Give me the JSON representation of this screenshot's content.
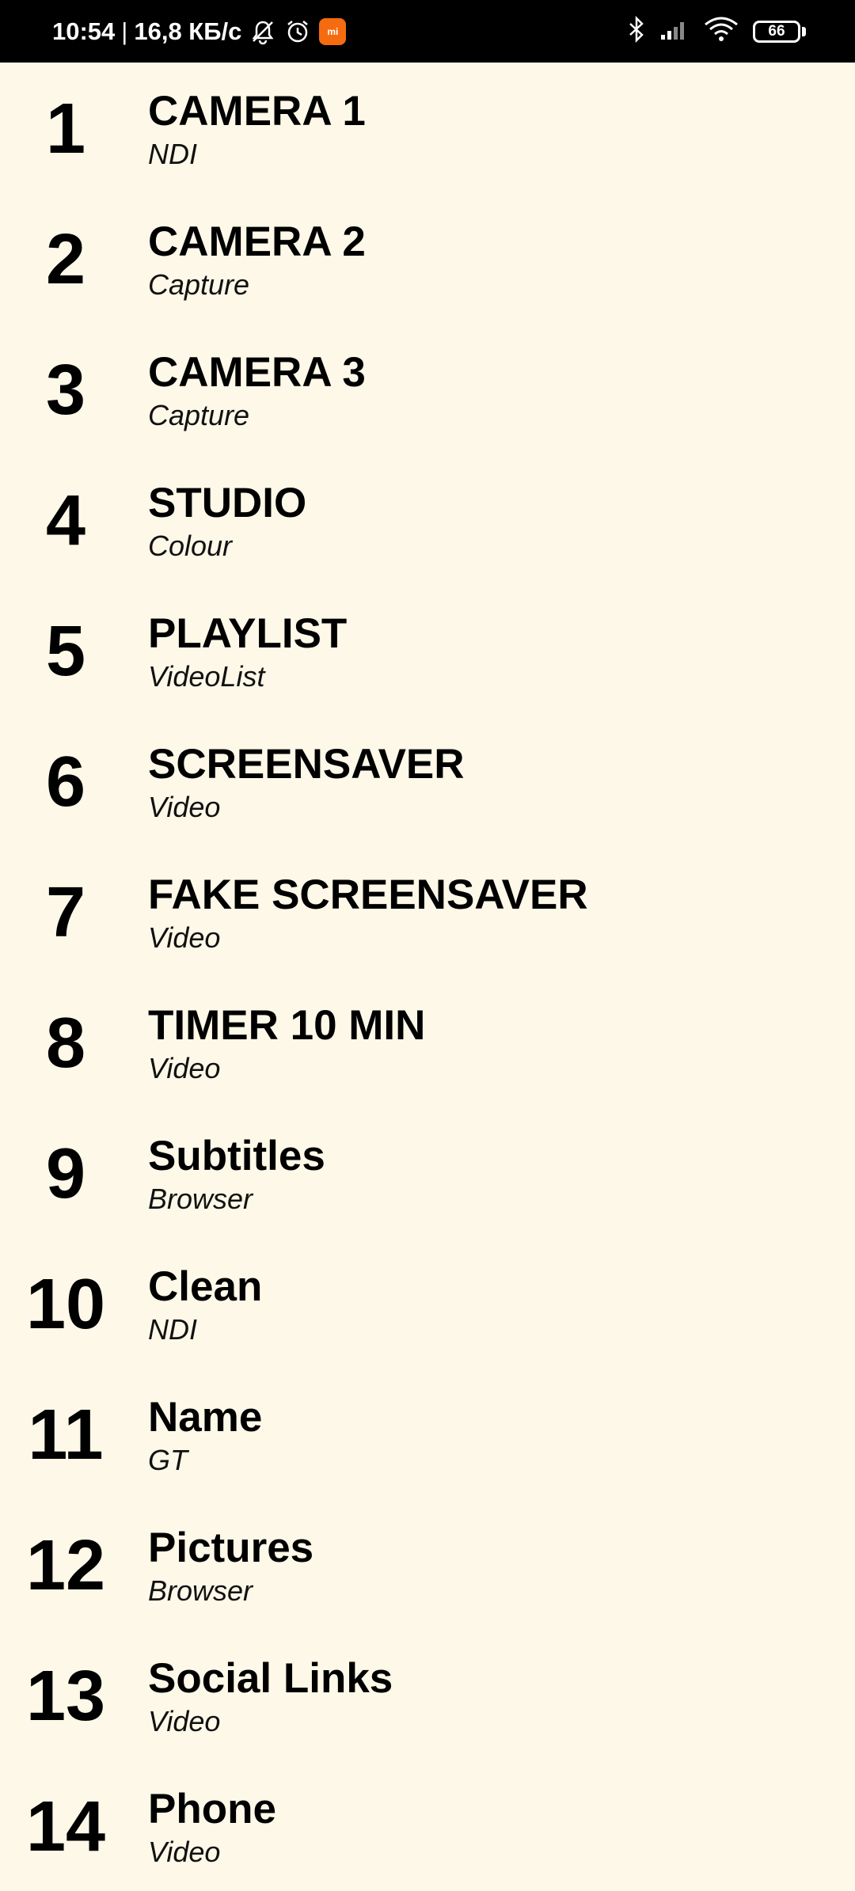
{
  "status_bar": {
    "time": "10:54",
    "separator": "|",
    "network_speed": "16,8 КБ/с",
    "battery_level": "66",
    "mi_label": "mi",
    "icons": [
      "mute-icon",
      "alarm-icon",
      "mi-app-icon",
      "bluetooth-icon",
      "signal-icon",
      "wifi-icon",
      "battery-icon"
    ]
  },
  "list": {
    "items": [
      {
        "number": "1",
        "name": "CAMERA 1",
        "type": "NDI"
      },
      {
        "number": "2",
        "name": "CAMERA 2",
        "type": "Capture"
      },
      {
        "number": "3",
        "name": "CAMERA 3",
        "type": "Capture"
      },
      {
        "number": "4",
        "name": "STUDIO",
        "type": "Colour"
      },
      {
        "number": "5",
        "name": "PLAYLIST",
        "type": "VideoList"
      },
      {
        "number": "6",
        "name": "SCREENSAVER",
        "type": "Video"
      },
      {
        "number": "7",
        "name": "FAKE SCREENSAVER",
        "type": "Video"
      },
      {
        "number": "8",
        "name": "TIMER 10 MIN",
        "type": "Video"
      },
      {
        "number": "9",
        "name": "Subtitles",
        "type": "Browser"
      },
      {
        "number": "10",
        "name": "Clean",
        "type": "NDI"
      },
      {
        "number": "11",
        "name": "Name",
        "type": "GT"
      },
      {
        "number": "12",
        "name": "Pictures",
        "type": "Browser"
      },
      {
        "number": "13",
        "name": "Social Links",
        "type": "Video"
      },
      {
        "number": "14",
        "name": "Phone",
        "type": "Video"
      }
    ]
  },
  "colors": {
    "background": "#fdf8e8",
    "status_bar": "#000000",
    "text": "#000000",
    "mi_badge": "#f56b10"
  }
}
